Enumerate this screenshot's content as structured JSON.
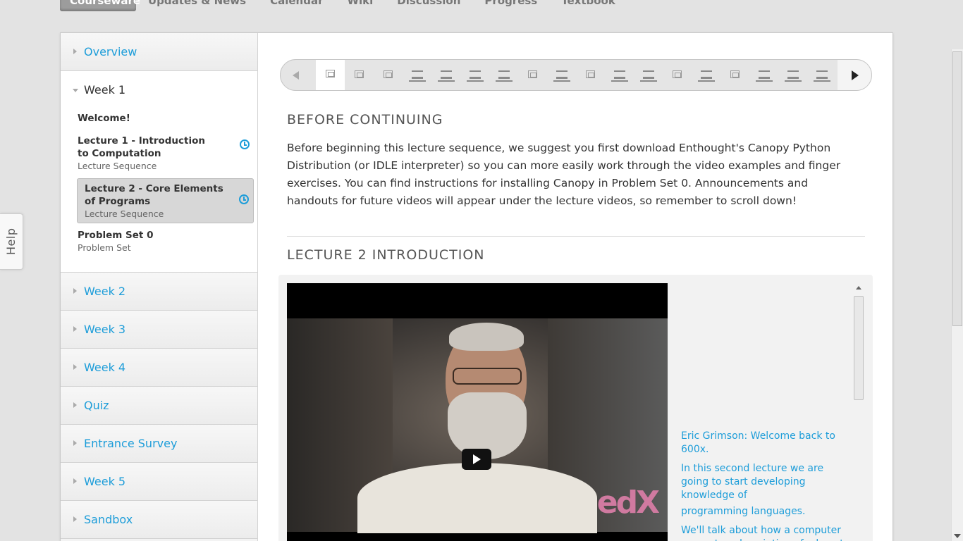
{
  "topnav": {
    "tabs": [
      "Courseware",
      "Updates & News",
      "Calendar",
      "Wiki",
      "Discussion",
      "Progress",
      "Textbook"
    ]
  },
  "help": {
    "label": "Help"
  },
  "sidebar": {
    "chapters": [
      {
        "label": "Overview"
      },
      {
        "label": "Week 1"
      },
      {
        "label": "Week 2"
      },
      {
        "label": "Week 3"
      },
      {
        "label": "Week 4"
      },
      {
        "label": "Quiz"
      },
      {
        "label": "Entrance Survey"
      },
      {
        "label": "Week 5"
      },
      {
        "label": "Sandbox"
      }
    ],
    "week1_sections": [
      {
        "name": "Welcome!",
        "kind": ""
      },
      {
        "name": "Lecture 1 - Introduction to Computation",
        "kind": "Lecture Sequence",
        "icon": "alarm-clock-icon"
      },
      {
        "name": "Lecture 2 - Core Elements of Programs",
        "kind": "Lecture Sequence",
        "icon": "alarm-clock-icon"
      },
      {
        "name": "Problem Set 0",
        "kind": "Problem Set"
      }
    ],
    "accent_color": "#1d9dd9"
  },
  "sequence_nav": {
    "items": [
      "video",
      "video",
      "video",
      "list",
      "list",
      "list",
      "list",
      "video",
      "list",
      "video",
      "list",
      "list",
      "video",
      "list",
      "video",
      "list",
      "list",
      "list"
    ],
    "active_index": 0
  },
  "content": {
    "heading1": "BEFORE CONTINUING",
    "paragraph": "Before beginning this lecture sequence, we suggest you first download Enthought's Canopy Python Distribution (or IDLE interpreter) so you can more easily work through the video examples and finger exercises. You can find instructions for installing Canopy in Problem Set 0. Announcements and handouts for future videos will appear under the lecture videos, so remember to scroll down!",
    "heading2": "LECTURE 2 INTRODUCTION",
    "watermark": "edX",
    "transcript": [
      "Eric Grimson: Welcome back to 600x.",
      "In this second lecture we are going to start developing knowledge of",
      "programming languages.",
      "We'll talk about how a computer converts a description of a how-to"
    ]
  }
}
